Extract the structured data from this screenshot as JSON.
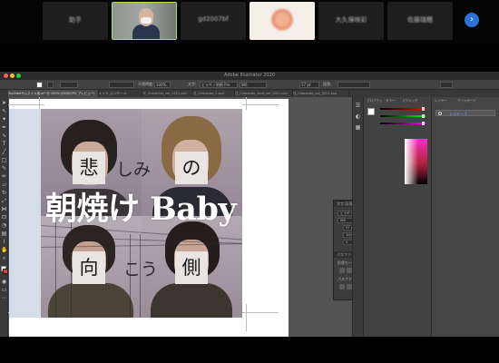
{
  "meeting": {
    "participants": [
      {
        "name": "助手",
        "type": "name"
      },
      {
        "name": "",
        "type": "camera"
      },
      {
        "name": "gd2007bf",
        "type": "name"
      },
      {
        "name": "",
        "type": "logo"
      },
      {
        "name": "大久保咲彩",
        "type": "name"
      },
      {
        "name": "佐藤瑞穂",
        "type": "name"
      }
    ],
    "next_icon": "chevron-right-icon"
  },
  "illustrator": {
    "window_title": "Adobe Illustrator 2020",
    "control_bar": {
      "zoom": "100%",
      "opacity_label": "不透明度:",
      "opacity_value": "100%",
      "char_label": "文字:",
      "font": "ヒラギノ明朝 Pro",
      "style": "W6",
      "size": "57 pt",
      "paragraph_label": "段落:"
    },
    "tabs": [
      "YouTubeサムネイル用.ai* @ 100% (RGB/GPU プレビュー)",
      "キャラ_ポスター.ai",
      "TF_Character_ver_2021.psd",
      "日_Character_2.psd",
      "日_Character_Sent_ver_2021.psd",
      "日_Character_ver_2021.psd"
    ],
    "artwork": {
      "row1_left": "悲",
      "row1_middle": "しみ",
      "row1_right": "の",
      "title": "朝焼け Baby",
      "row2_left": "向",
      "row2_middle": "こう",
      "row2_right": "側"
    },
    "character_panel": {
      "tabs": "文字  段落  OpenType",
      "font": "ヒラギノ明朝 Pro",
      "style": "W6",
      "size": "57 pt",
      "leading": "(83.4 pt)",
      "scale_h": "100%",
      "scale_v": "100%",
      "tracking": "0",
      "kerning": "0",
      "pathfinder_label": "パスファインダー",
      "shape_mode": "形状モード：",
      "pathfinder_mode": "パスファインダー："
    },
    "dock": {
      "tab_properties": "プロパティ",
      "tab_color": "カラー",
      "tab_swatches": "スウォッチ",
      "tab_layers": "レイヤー",
      "tab_artboards": "アートボード",
      "layer_name": "レイヤー 1"
    }
  },
  "colors": {
    "accent": "#2a73d6",
    "active_speaker": "#b7dc60",
    "artboard": "#ffffff",
    "title_text": "#ffffff"
  }
}
